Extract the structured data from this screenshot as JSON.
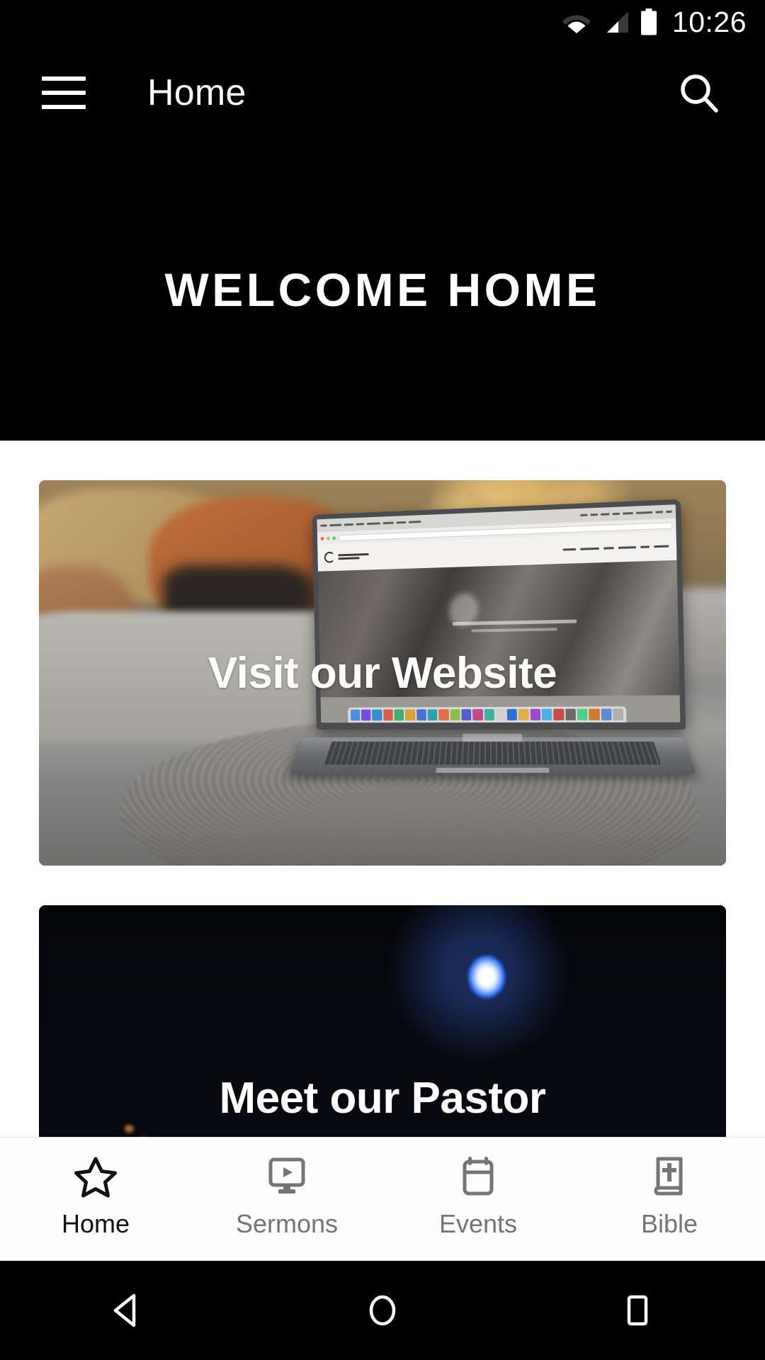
{
  "status_bar": {
    "time": "10:26",
    "wifi_icon": "wifi-icon",
    "cellular_icon": "cellular-signal-icon",
    "battery_icon": "battery-full-icon"
  },
  "app_bar": {
    "menu_icon": "hamburger-menu-icon",
    "title": "Home",
    "search_icon": "search-icon"
  },
  "hero": {
    "title": "WELCOME HOME",
    "background_color": "#000000"
  },
  "cards": [
    {
      "title": "Visit our Website",
      "name": "card-visit-our-website",
      "artwork": "laptop-on-table-photo"
    },
    {
      "title": "Meet our Pastor",
      "name": "card-meet-our-pastor",
      "artwork": "pastor-on-stage-photo"
    }
  ],
  "bottom_nav": {
    "active_index": 0,
    "active_color": "#111111",
    "inactive_color": "#757575",
    "items": [
      {
        "label": "Home",
        "icon": "star-icon",
        "name": "nav-item-home"
      },
      {
        "label": "Sermons",
        "icon": "video-monitor-icon",
        "name": "nav-item-sermons"
      },
      {
        "label": "Events",
        "icon": "calendar-icon",
        "name": "nav-item-events"
      },
      {
        "label": "Bible",
        "icon": "book-with-cross-icon",
        "name": "nav-item-bible"
      }
    ]
  },
  "system_nav": {
    "back_icon": "back-triangle-icon",
    "home_icon": "home-circle-icon",
    "recents_icon": "recents-square-icon"
  }
}
